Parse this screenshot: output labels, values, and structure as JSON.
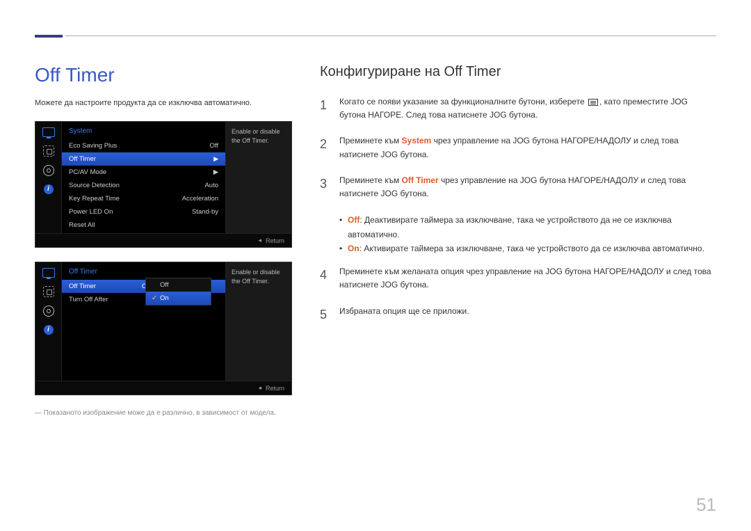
{
  "header": {
    "marker": ""
  },
  "left": {
    "title": "Off Timer",
    "desc": "Можете да настроите продукта да се изключва автоматично.",
    "osd1": {
      "title": "System",
      "rows": [
        {
          "label": "Eco Saving Plus",
          "value": "Off"
        },
        {
          "label": "Off Timer",
          "value": "▶"
        },
        {
          "label": "PC/AV Mode",
          "value": "▶"
        },
        {
          "label": "Source Detection",
          "value": "Auto"
        },
        {
          "label": "Key Repeat Time",
          "value": "Acceleration"
        },
        {
          "label": "Power LED On",
          "value": "Stand-by"
        },
        {
          "label": "Reset All",
          "value": ""
        }
      ],
      "help": "Enable or disable the Off Timer.",
      "return": "Return"
    },
    "osd2": {
      "title": "Off Timer",
      "rows": [
        {
          "label": "Off Timer",
          "value": "Off"
        },
        {
          "label": "Turn Off After",
          "value": ""
        }
      ],
      "popup": {
        "opt1": "Off",
        "opt2": "On"
      },
      "help": "Enable or disable the Off Timer.",
      "return": "Return"
    },
    "footnote": "― Показаното изображение може да е различно, в зависимост от модела."
  },
  "right": {
    "subtitle": "Конфигуриране на Off Timer",
    "step1a": "Когато се появи указание за функционалните бутони, изберете ",
    "step1b": ", като преместите JOG бутона НАГОРЕ. След това натиснете JOG бутона.",
    "step2a": "Преминете към ",
    "step2_system": "System",
    "step2b": " чрез управление на JOG бутона НАГОРЕ/НАДОЛУ и след това натиснете JOG бутона.",
    "step3a": "Преминете към ",
    "step3_offtimer": "Off Timer",
    "step3b": " чрез управление на JOG бутона НАГОРЕ/НАДОЛУ и след това натиснете JOG бутона.",
    "bullet1_kw": "Off",
    "bullet1": ": Деактивирате таймера за изключване, така че устройството да не се изключва автоматично.",
    "bullet2_kw": "On",
    "bullet2": ": Активирате таймера за изключване, така че устройството да се изключва автоматично.",
    "step4": "Преминете към желаната опция чрез управление на JOG бутона НАГОРЕ/НАДОЛУ и след това натиснете JOG бутона.",
    "step5": "Избраната опция ще се приложи.",
    "nums": {
      "n1": "1",
      "n2": "2",
      "n3": "3",
      "n4": "4",
      "n5": "5"
    }
  },
  "page_number": "51"
}
